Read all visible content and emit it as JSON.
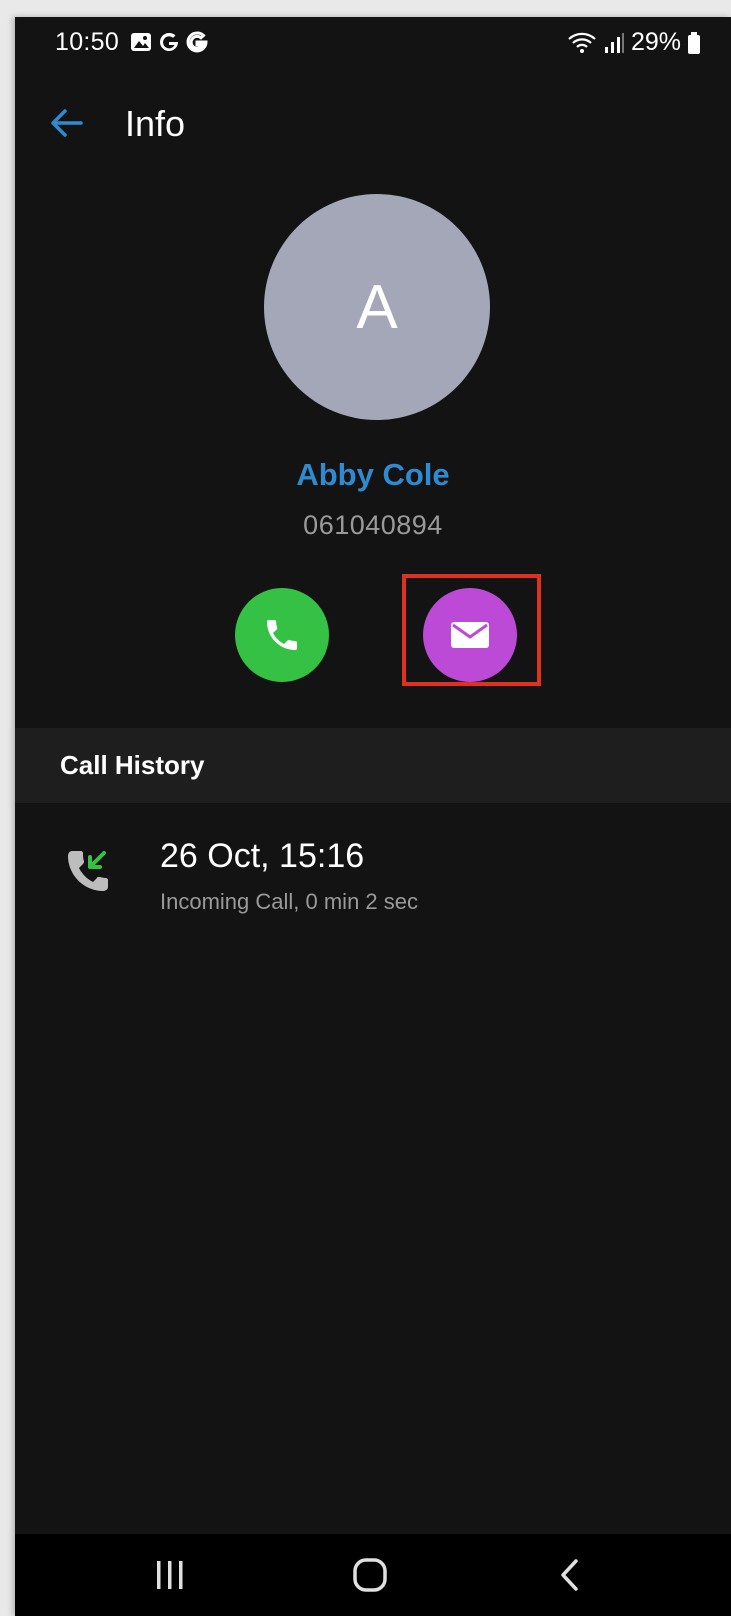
{
  "status_bar": {
    "time": "10:50",
    "battery": "29%"
  },
  "app_bar": {
    "title": "Info"
  },
  "contact": {
    "initial": "A",
    "name": "Abby Cole",
    "number": "061040894"
  },
  "actions": {
    "call_icon": "phone-icon",
    "message_icon": "envelope-icon"
  },
  "call_history": {
    "section_title": "Call History",
    "entries": [
      {
        "date": "26 Oct, 15:16",
        "detail": "Incoming Call, 0 min 2 sec",
        "icon": "incoming-call-icon"
      }
    ]
  },
  "colors": {
    "background": "#131313",
    "accent_blue": "#2f8ad0",
    "call_green": "#35c144",
    "message_purple": "#bc4ad7",
    "avatar_gray": "#a3a7b8",
    "highlight_red": "#e0301e"
  }
}
